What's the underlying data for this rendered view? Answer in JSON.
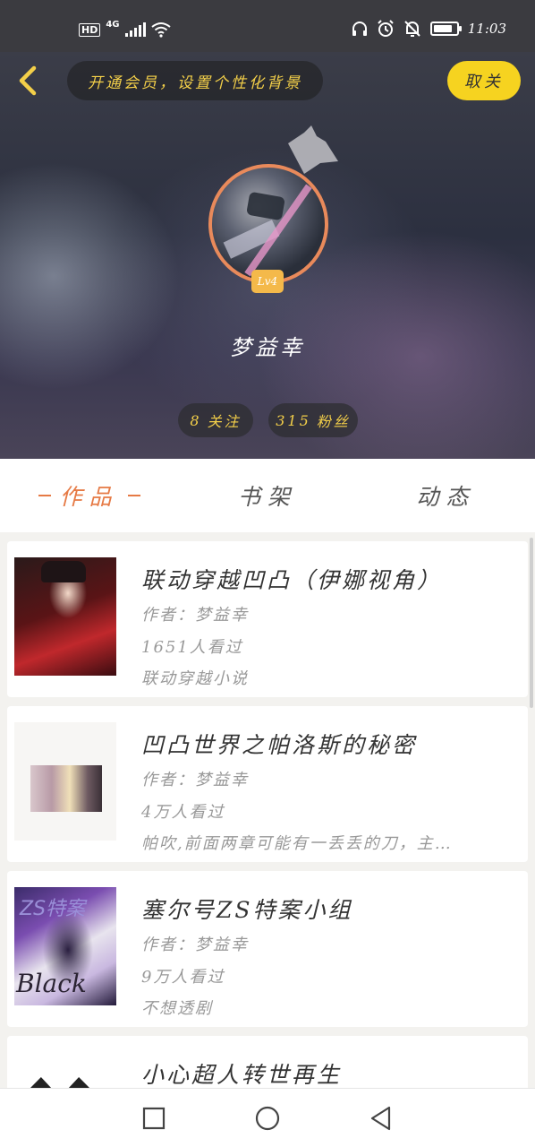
{
  "status_bar": {
    "hd": "HD",
    "network": "4G",
    "time": "11:03",
    "battery_level": 0.85
  },
  "header": {
    "vip_banner": "开通会员，设置个性化背景",
    "cancel_label": "取关",
    "level": "Lv4",
    "username": "梦益幸",
    "follow_count": "8",
    "follow_label": "关注",
    "fans_count": "315",
    "fans_label": "粉丝"
  },
  "tabs": [
    {
      "label": "作品",
      "active": true
    },
    {
      "label": "书架",
      "active": false
    },
    {
      "label": "动态",
      "active": false
    }
  ],
  "works": [
    {
      "title": "联动穿越凹凸（伊娜视角）",
      "author": "作者：梦益幸",
      "views": "1651人看过",
      "desc": "联动穿越小说"
    },
    {
      "title": "凹凸世界之帕洛斯的秘密",
      "author": "作者：梦益幸",
      "views": "4万人看过",
      "desc": "帕吹,前面两章可能有一丢丢的刀，主…"
    },
    {
      "title": "塞尔号ZS特案小组",
      "author": "作者：梦益幸",
      "views": "9万人看过",
      "desc": "不想透剧",
      "cover_text_1": "ZS特案",
      "cover_text_2": "Black"
    },
    {
      "title": "小心超人转世再生",
      "author": "",
      "views": "",
      "desc": ""
    }
  ],
  "colors": {
    "accent": "#e67a45",
    "gold": "#f3cf49",
    "cancel_button": "#f6d320"
  }
}
